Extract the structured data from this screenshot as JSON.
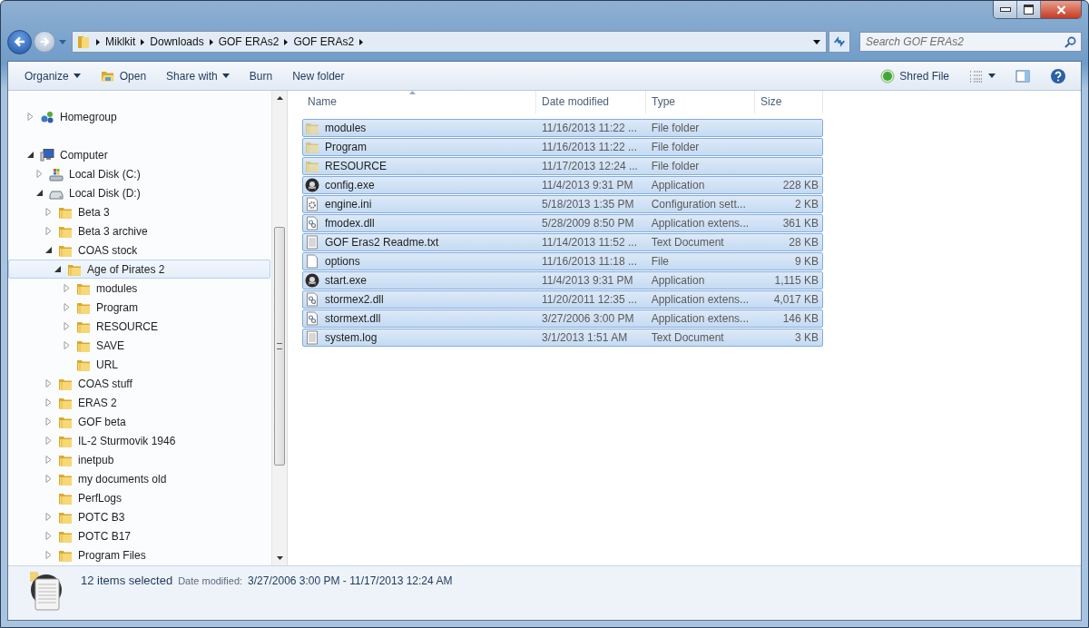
{
  "address_bar": {
    "crumbs": [
      "Miklkit",
      "Downloads",
      "GOF ERAs2",
      "GOF ERAs2"
    ]
  },
  "search": {
    "placeholder": "Search GOF ERAs2"
  },
  "toolbar": {
    "items": [
      {
        "label": "Organize",
        "kind": "menu"
      },
      {
        "label": "Open",
        "kind": "open"
      },
      {
        "label": "Share with",
        "kind": "menu"
      },
      {
        "label": "Burn",
        "kind": "plain"
      },
      {
        "label": "New folder",
        "kind": "plain"
      }
    ],
    "right": {
      "label": "Shred File"
    }
  },
  "nav_tree": [
    {
      "label": "Homegroup",
      "kind": "homegroup",
      "expandable": true,
      "expanded": false,
      "selected": false
    },
    {
      "label": "Computer",
      "kind": "computer",
      "expandable": true,
      "expanded": true,
      "selected": false,
      "children": [
        {
          "label": "Local Disk (C:)",
          "kind": "system-drive",
          "expandable": true,
          "expanded": false,
          "selected": false
        },
        {
          "label": "Local Disk (D:)",
          "kind": "drive",
          "expandable": true,
          "expanded": true,
          "selected": false,
          "children": [
            {
              "label": "Beta 3",
              "kind": "folder",
              "expandable": true,
              "expanded": false,
              "selected": false
            },
            {
              "label": "Beta 3 archive",
              "kind": "folder",
              "expandable": true,
              "expanded": false,
              "selected": false
            },
            {
              "label": "COAS stock",
              "kind": "folder",
              "expandable": true,
              "expanded": true,
              "selected": false,
              "children": [
                {
                  "label": "Age of Pirates 2",
                  "kind": "folder",
                  "expandable": true,
                  "expanded": true,
                  "selected": true,
                  "children": [
                    {
                      "label": "modules",
                      "kind": "folder",
                      "expandable": true,
                      "expanded": false,
                      "selected": false
                    },
                    {
                      "label": "Program",
                      "kind": "folder",
                      "expandable": true,
                      "expanded": false,
                      "selected": false
                    },
                    {
                      "label": "RESOURCE",
                      "kind": "folder",
                      "expandable": true,
                      "expanded": false,
                      "selected": false
                    },
                    {
                      "label": "SAVE",
                      "kind": "folder",
                      "expandable": true,
                      "expanded": false,
                      "selected": false
                    },
                    {
                      "label": "URL",
                      "kind": "folder",
                      "expandable": false,
                      "expanded": false,
                      "selected": false
                    }
                  ]
                }
              ]
            },
            {
              "label": "COAS stuff",
              "kind": "folder",
              "expandable": true,
              "expanded": false,
              "selected": false
            },
            {
              "label": "ERAS 2",
              "kind": "folder",
              "expandable": true,
              "expanded": false,
              "selected": false
            },
            {
              "label": "GOF beta",
              "kind": "folder",
              "expandable": true,
              "expanded": false,
              "selected": false
            },
            {
              "label": "IL-2 Sturmovik 1946",
              "kind": "folder",
              "expandable": true,
              "expanded": false,
              "selected": false
            },
            {
              "label": "inetpub",
              "kind": "folder",
              "expandable": true,
              "expanded": false,
              "selected": false
            },
            {
              "label": "my documents old",
              "kind": "folder",
              "expandable": true,
              "expanded": false,
              "selected": false
            },
            {
              "label": "PerfLogs",
              "kind": "folder",
              "expandable": false,
              "expanded": false,
              "selected": false
            },
            {
              "label": "POTC B3",
              "kind": "folder",
              "expandable": true,
              "expanded": false,
              "selected": false
            },
            {
              "label": "POTC B17",
              "kind": "folder",
              "expandable": true,
              "expanded": false,
              "selected": false
            },
            {
              "label": "Program Files",
              "kind": "folder",
              "expandable": true,
              "expanded": false,
              "selected": false
            }
          ]
        }
      ]
    }
  ],
  "table": {
    "columns": [
      "Name",
      "Date modified",
      "Type",
      "Size"
    ],
    "rows": [
      {
        "name": "modules",
        "kind": "folder",
        "date": "11/16/2013 11:22 ...",
        "type": "File folder",
        "size": "",
        "selected": true
      },
      {
        "name": "Program",
        "kind": "folder",
        "date": "11/16/2013 11:22 ...",
        "type": "File folder",
        "size": "",
        "selected": true
      },
      {
        "name": "RESOURCE",
        "kind": "folder",
        "date": "11/17/2013 12:24 ...",
        "type": "File folder",
        "size": "",
        "selected": true
      },
      {
        "name": "config.exe",
        "kind": "exe",
        "date": "11/4/2013 9:31 PM",
        "type": "Application",
        "size": "228 KB",
        "selected": true
      },
      {
        "name": "engine.ini",
        "kind": "ini",
        "date": "5/18/2013 1:35 PM",
        "type": "Configuration sett...",
        "size": "2 KB",
        "selected": true
      },
      {
        "name": "fmodex.dll",
        "kind": "dll",
        "date": "5/28/2009 8:50 PM",
        "type": "Application extens...",
        "size": "361 KB",
        "selected": true
      },
      {
        "name": "GOF Eras2 Readme.txt",
        "kind": "txt",
        "date": "11/14/2013 11:52 ...",
        "type": "Text Document",
        "size": "28 KB",
        "selected": true
      },
      {
        "name": "options",
        "kind": "file",
        "date": "11/16/2013 11:18 ...",
        "type": "File",
        "size": "9 KB",
        "selected": true
      },
      {
        "name": "start.exe",
        "kind": "exe",
        "date": "11/4/2013 9:31 PM",
        "type": "Application",
        "size": "1,115 KB",
        "selected": true
      },
      {
        "name": "stormex2.dll",
        "kind": "dll",
        "date": "11/20/2011 12:35 ...",
        "type": "Application extens...",
        "size": "4,017 KB",
        "selected": true
      },
      {
        "name": "stormext.dll",
        "kind": "dll",
        "date": "3/27/2006 3:00 PM",
        "type": "Application extens...",
        "size": "146 KB",
        "selected": true
      },
      {
        "name": "system.log",
        "kind": "txt",
        "date": "3/1/2013 1:51 AM",
        "type": "Text Document",
        "size": "3 KB",
        "selected": true
      }
    ]
  },
  "status_bar": {
    "count": "12 items selected",
    "date_label": "Date modified:",
    "date_value": "3/27/2006 3:00 PM - 11/17/2013 12:24 AM"
  }
}
